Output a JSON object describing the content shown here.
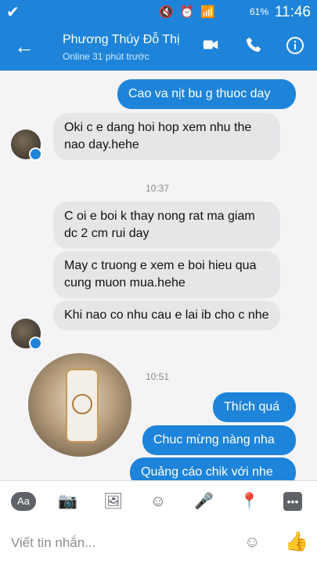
{
  "status": {
    "battery": "61%",
    "time": "11:46"
  },
  "header": {
    "name": "Phương Thúy Đỗ Thị",
    "subtitle": "Online 31 phút trước"
  },
  "messages": {
    "m1": "Cao va nịt bu g thuoc day",
    "m2": "Oki c e dang hoi hop xem nhu the nao day.hehe",
    "ts1": "10:37",
    "m3": "C oi e boi k thay nong rat ma giam dc 2 cm rui day",
    "m4": "May c truong e xem e boi hieu qua cung muon mua.hehe",
    "m5": "Khi nao co nhu cau e lai ib cho c nhe",
    "ts2": "10:51",
    "m6": "Thích quá",
    "m7": "Chuc mừng nàng nha",
    "m8": "Quảng cáo chik với nhe"
  },
  "composer": {
    "placeholder": "Viết tin nhắn..."
  },
  "toolbar": {
    "aa_label": "Aa"
  },
  "colors": {
    "accent": "#1e84d9",
    "incoming": "#e6e6e9"
  }
}
